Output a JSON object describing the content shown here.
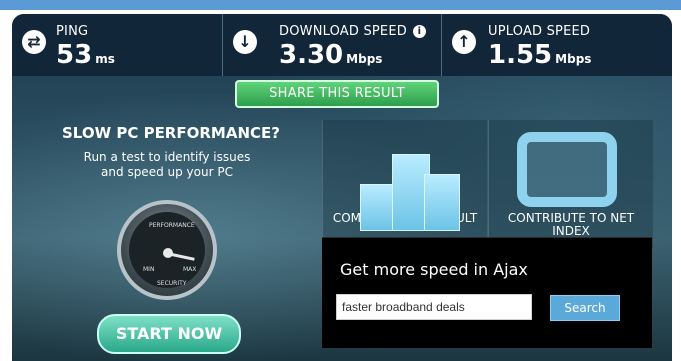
{
  "stats": {
    "ping": {
      "label": "PING",
      "value": "53",
      "unit": "ms"
    },
    "download": {
      "label": "DOWNLOAD SPEED",
      "value": "3.30",
      "unit": "Mbps"
    },
    "upload": {
      "label": "UPLOAD SPEED",
      "value": "1.55",
      "unit": "Mbps"
    }
  },
  "share_label": "SHARE THIS RESULT",
  "promo": {
    "title": "SLOW PC PERFORMANCE?",
    "text": "Run a test to identify issues and speed up your PC",
    "gauge": {
      "performance": "PERFORMANCE",
      "min": "MIN",
      "max": "MAX",
      "security": "SECURITY"
    },
    "start_label": "START NOW"
  },
  "tiles": {
    "compare": "COMPARE YOUR RESULT",
    "contribute": "CONTRIBUTE TO NET INDEX"
  },
  "ad": {
    "title": "Get more speed in Ajax",
    "input_value": "faster broadband deals",
    "search_label": "Search"
  },
  "colors": {
    "accent_green": "#2e9e4c",
    "panel_dark": "#12263a",
    "search_blue": "#5ba9d8"
  }
}
